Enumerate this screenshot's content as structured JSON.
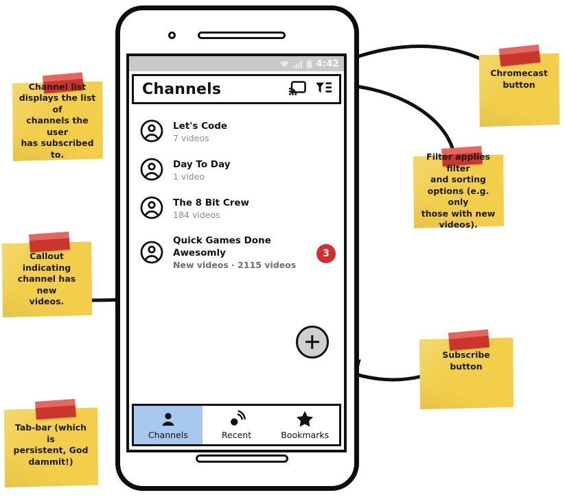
{
  "device": {
    "name": "phone-mockup",
    "status_bar": {
      "time": "4:42",
      "icons": [
        "wifi-icon",
        "cellular-signal-icon",
        "battery-icon"
      ]
    }
  },
  "app": {
    "header": {
      "title": "Channels",
      "actions": [
        {
          "name": "chromecast-button",
          "icon": "chromecast-icon"
        },
        {
          "name": "filter-button",
          "icon": "filter-icon"
        }
      ]
    },
    "channels": [
      {
        "title": "Let's Code",
        "subtitle": "7 videos",
        "unread": false,
        "badge": ""
      },
      {
        "title": "Day To Day",
        "subtitle": "1 video",
        "unread": false,
        "badge": ""
      },
      {
        "title": "The 8 Bit Crew",
        "subtitle": "184 videos",
        "unread": false,
        "badge": ""
      },
      {
        "title": "Quick Games Done Awesomly",
        "subtitle": "New videos · 2115 videos",
        "unread": true,
        "badge": "3"
      }
    ],
    "fab": {
      "label": "+",
      "name": "subscribe-fab"
    },
    "tabs": [
      {
        "label": "Channels",
        "icon": "account-circle-icon",
        "selected": true
      },
      {
        "label": "Recent",
        "icon": "recent-broadcast-icon",
        "selected": false
      },
      {
        "label": "Bookmarks",
        "icon": "star-icon",
        "selected": false
      }
    ]
  },
  "notes": [
    {
      "id": "note-channel-list",
      "text": "Channel list\ndisplays the list of\nchannels the user\nhas subscribed to."
    },
    {
      "id": "note-chromecast",
      "text": "Chromecast\nbutton"
    },
    {
      "id": "note-filter",
      "text": "Filter applies filter\nand sorting\noptions (e.g. only\nthose with new\nvideos)."
    },
    {
      "id": "note-callout",
      "text": "Callout indicating\nchannel has new\nvideos."
    },
    {
      "id": "note-subscribe",
      "text": "Subscribe button"
    },
    {
      "id": "note-tabbar",
      "text": "Tab-bar (which is\npersistent, God\ndammit!)"
    }
  ],
  "colors": {
    "note_yellow": "#f2ce4b",
    "tape_red": "#db3b32",
    "badge_red": "#d42e2e",
    "tab_selected_blue": "#a8c8ee",
    "status_bar_gray": "#c9c9c9",
    "fab_gray": "#cfcfcf",
    "ink_black": "#111111"
  }
}
